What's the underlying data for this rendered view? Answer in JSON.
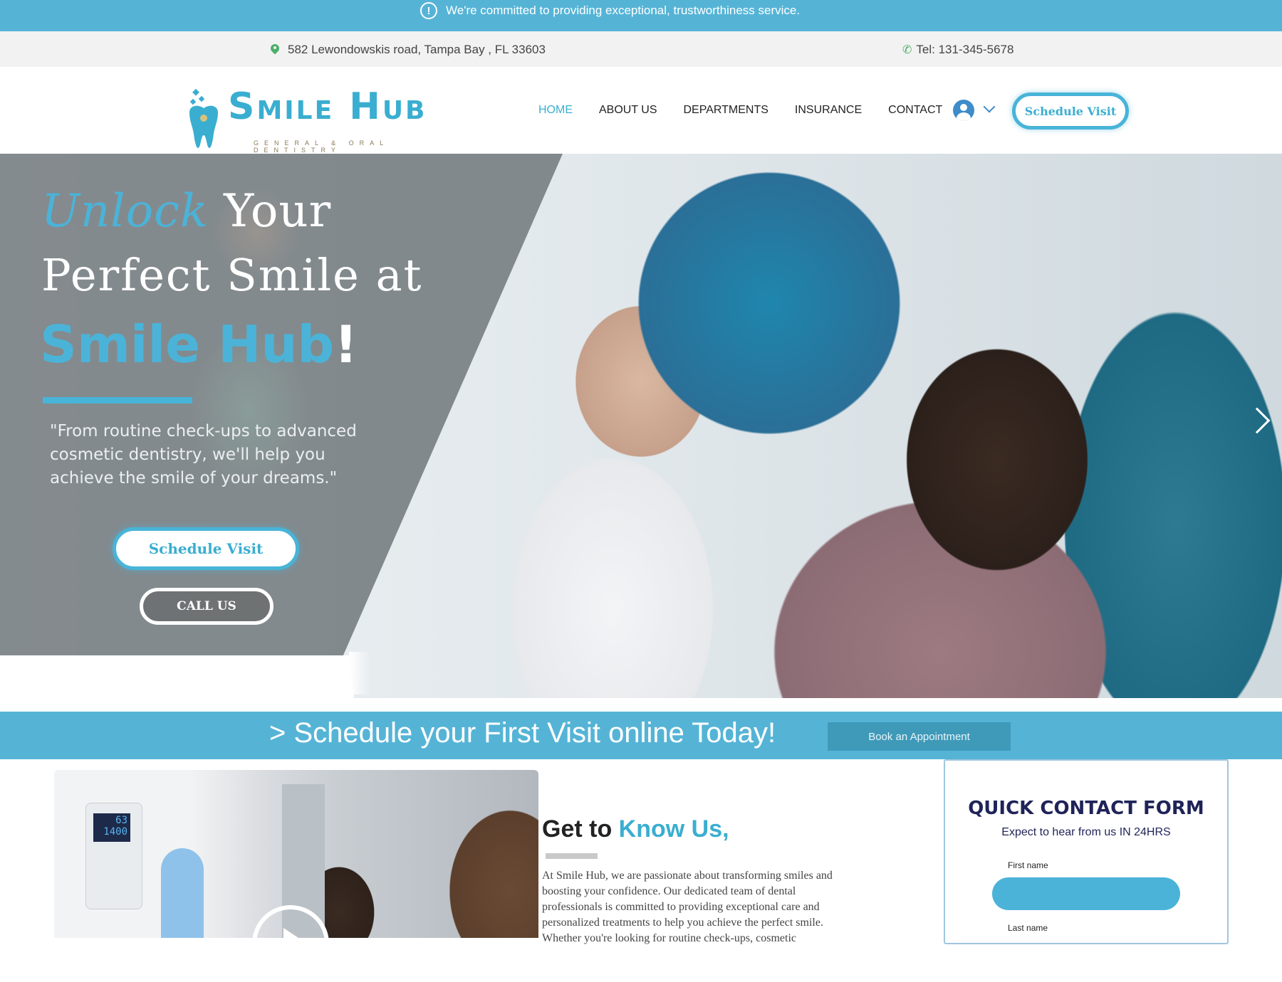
{
  "announcement": {
    "icon": "alert-circle-icon",
    "text": "We're committed to providing exceptional, trustworthiness service."
  },
  "info": {
    "address": "582 Lewondowskis road, Tampa Bay , FL 33603",
    "phone": "Tel: 131-345-5678"
  },
  "logo": {
    "name": "Smile Hub",
    "tagline": "GENERAL & ORAL DENTISTRY"
  },
  "nav": {
    "items": [
      {
        "label": "HOME",
        "active": true
      },
      {
        "label": "ABOUT US"
      },
      {
        "label": "DEPARTMENTS"
      },
      {
        "label": "INSURANCE"
      },
      {
        "label": "CONTACT"
      }
    ],
    "schedule_label": "Schedule Visit"
  },
  "hero": {
    "line1_accent": "Unlock",
    "line1_rest": " Your",
    "line2": "Perfect Smile at",
    "line3_accent": "Smile Hub",
    "line3_rest": "!",
    "quote": "\"From routine check-ups to advanced cosmetic dentistry, we'll help you achieve the smile of your dreams.\"",
    "schedule_label": "Schedule Visit",
    "call_label": "CALL US"
  },
  "strip": {
    "text": "> Schedule your First Visit online Today!",
    "book_label": "Book an Appointment"
  },
  "video": {
    "lcd_top": "63",
    "lcd_bottom": "1400"
  },
  "about": {
    "title": "Get to ",
    "title_accent": "Know Us,",
    "body": "At Smile Hub, we are passionate about transforming smiles and boosting your confidence. Our dedicated team of dental professionals is committed to providing exceptional care and personalized treatments to help you achieve the perfect smile. Whether you're looking for routine check-ups, cosmetic"
  },
  "contact_form": {
    "title": "QUICK CONTACT FORM",
    "subtitle": "Expect to hear from us IN 24HRS",
    "first_name_label": "First name",
    "last_name_label": "Last name"
  },
  "colors": {
    "accent": "#55b4d6",
    "navy": "#1f2358"
  }
}
